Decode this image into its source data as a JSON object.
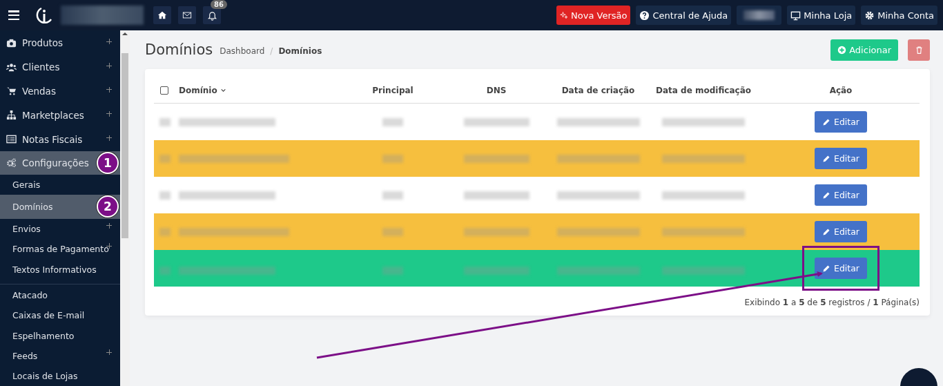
{
  "topbar": {
    "notification_count": "86",
    "buttons": [
      {
        "label": "Nova Versão",
        "kind": "new"
      },
      {
        "label": "Central de Ajuda",
        "kind": "help"
      },
      {
        "kind": "hidden"
      },
      {
        "label": "Minha Loja",
        "kind": "store"
      },
      {
        "label": "Minha Conta",
        "kind": "account"
      }
    ]
  },
  "sidebar": {
    "items": [
      {
        "label": "Produtos",
        "kind": "menu",
        "expandable": true,
        "selected": false
      },
      {
        "label": "Clientes",
        "kind": "menu",
        "expandable": true,
        "selected": false
      },
      {
        "label": "Vendas",
        "kind": "menu",
        "expandable": true,
        "selected": false
      },
      {
        "label": "Marketplaces",
        "kind": "menu",
        "expandable": true,
        "selected": false
      },
      {
        "label": "Notas Fiscais",
        "kind": "menu",
        "expandable": true,
        "selected": false
      },
      {
        "label": "Configurações",
        "kind": "menu",
        "expandable": false,
        "selected": true,
        "step": "1"
      },
      {
        "label": "Gerais",
        "kind": "submenu",
        "expandable": false,
        "selected": false
      },
      {
        "label": "Domínios",
        "kind": "submenu",
        "expandable": false,
        "selected": true,
        "step": "2"
      },
      {
        "label": "Envios",
        "kind": "submenu",
        "expandable": true,
        "selected": false
      },
      {
        "label": "Formas de Pagamento",
        "kind": "submenu",
        "expandable": true,
        "selected": false
      },
      {
        "label": "Textos Informativos",
        "kind": "submenu",
        "expandable": false,
        "selected": false
      },
      {
        "label": "Atacado",
        "kind": "divided",
        "expandable": false,
        "selected": false
      },
      {
        "label": "Caixas de E-mail",
        "kind": "submenu",
        "expandable": false,
        "selected": false
      },
      {
        "label": "Espelhamento",
        "kind": "submenu",
        "expandable": false,
        "selected": false
      },
      {
        "label": "Feeds",
        "kind": "submenu",
        "expandable": true,
        "selected": false
      },
      {
        "label": "Locais de Lojas",
        "kind": "submenu",
        "expandable": false,
        "selected": false
      }
    ]
  },
  "page": {
    "title": "Domínios",
    "breadcrumb": [
      "Dashboard",
      "Domínios"
    ],
    "breadcrumb_separator": "/",
    "add_button": "Adicionar"
  },
  "table": {
    "select_all_checked": false,
    "columns": [
      "Domínio",
      "Principal",
      "DNS",
      "Data de criação",
      "Data de modificação",
      "Ação"
    ],
    "rows": [
      {
        "color": "#ffffff",
        "action": "Editar",
        "highlighted": false
      },
      {
        "color": "#f6bf3e",
        "action": "Editar",
        "highlighted": false
      },
      {
        "color": "#ffffff",
        "action": "Editar",
        "highlighted": false
      },
      {
        "color": "#f6bf3e",
        "action": "Editar",
        "highlighted": false
      },
      {
        "color": "#1ec98a",
        "action": "Editar",
        "highlighted": true
      }
    ],
    "footer": "Exibindo **1** a **5** de **5** registros / **1** Página(s)"
  }
}
